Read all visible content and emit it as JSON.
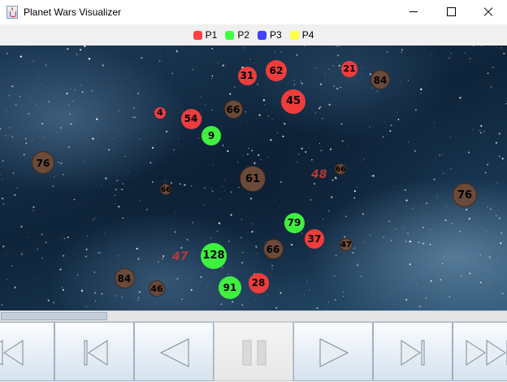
{
  "window": {
    "title": "Planet Wars Visualizer"
  },
  "legend": [
    {
      "label": "P1",
      "color": "#ff4040"
    },
    {
      "label": "P2",
      "color": "#40ff40"
    },
    {
      "label": "P3",
      "color": "#4040ff"
    },
    {
      "label": "P4",
      "color": "#ffff40"
    }
  ],
  "colors": {
    "p1": "#f03c3c",
    "p2": "#3ff03f",
    "neutral": "#6b4a3a",
    "fleet": "#b33a3a"
  },
  "planets": [
    {
      "ships": "4",
      "owner": "p1"
    },
    {
      "ships": "54",
      "owner": "p1"
    },
    {
      "ships": "9",
      "owner": "p2"
    },
    {
      "ships": "66",
      "owner": "neutral"
    },
    {
      "ships": "31",
      "owner": "p1"
    },
    {
      "ships": "62",
      "owner": "p1"
    },
    {
      "ships": "45",
      "owner": "p1"
    },
    {
      "ships": "21",
      "owner": "p1"
    },
    {
      "ships": "84",
      "owner": "neutral"
    },
    {
      "ships": "76",
      "owner": "neutral"
    },
    {
      "ships": "61",
      "owner": "neutral"
    },
    {
      "ships": "66",
      "owner": "neutral"
    },
    {
      "ships": "66",
      "owner": "neutral"
    },
    {
      "ships": "76",
      "owner": "neutral"
    },
    {
      "ships": "79",
      "owner": "p2"
    },
    {
      "ships": "37",
      "owner": "p1"
    },
    {
      "ships": "66",
      "owner": "neutral"
    },
    {
      "ships": "47",
      "owner": "neutral"
    },
    {
      "ships": "128",
      "owner": "p2"
    },
    {
      "ships": "84",
      "owner": "neutral"
    },
    {
      "ships": "46",
      "owner": "neutral"
    },
    {
      "ships": "91",
      "owner": "p2"
    },
    {
      "ships": "28",
      "owner": "p1"
    }
  ],
  "fleets": [
    {
      "ships": "48",
      "owner": "p1"
    },
    {
      "ships": "47",
      "owner": "p1"
    }
  ],
  "timeline": {
    "progress": 0.21
  },
  "controls": [
    {
      "name": "skip-to-start-button",
      "icon": "skip-to-start-icon"
    },
    {
      "name": "step-back-button",
      "icon": "step-back-icon"
    },
    {
      "name": "play-backward-button",
      "icon": "play-backward-icon"
    },
    {
      "name": "pause-button",
      "icon": "pause-icon",
      "active": true
    },
    {
      "name": "play-button",
      "icon": "play-icon"
    },
    {
      "name": "step-forward-button",
      "icon": "step-forward-icon"
    },
    {
      "name": "skip-to-end-button",
      "icon": "skip-to-end-icon"
    }
  ]
}
